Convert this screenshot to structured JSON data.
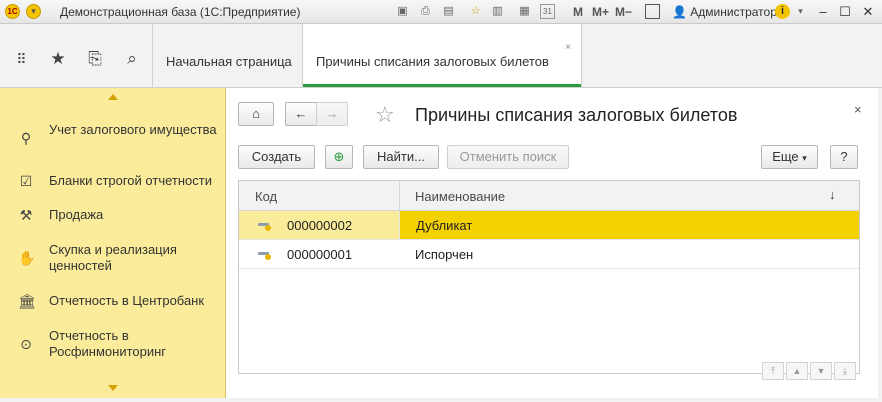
{
  "window": {
    "title": "Демонстрационная база  (1С:Предприятие)",
    "user": "Администратор",
    "m_labels": [
      "M",
      "M+",
      "M−"
    ],
    "calendar_day": "31"
  },
  "nav": {
    "tabs": [
      {
        "label": "Начальная страница",
        "active": false
      },
      {
        "label": "Причины списания залоговых билетов",
        "active": true
      }
    ],
    "tab_close": "×"
  },
  "sidebar": {
    "items": [
      {
        "label": "Учет залогового имущества",
        "icon": "ring-icon"
      },
      {
        "label": "Бланки строгой отчетности",
        "icon": "checklist-icon"
      },
      {
        "label": "Продажа",
        "icon": "sale-icon"
      },
      {
        "label": "Скупка и реализация ценностей",
        "icon": "hand-icon"
      },
      {
        "label": "Отчетность в Центробанк",
        "icon": "bank-icon"
      },
      {
        "label": "Отчетность в Росфинмониторинг",
        "icon": "magnifier-icon"
      }
    ]
  },
  "form": {
    "title": "Причины списания залоговых билетов",
    "close": "×",
    "buttons": {
      "create": "Создать",
      "find": "Найти...",
      "cancel_search": "Отменить поиск",
      "more": "Еще",
      "help": "?"
    },
    "table": {
      "columns": [
        "Код",
        "Наименование"
      ],
      "sort_indicator": "↓",
      "rows": [
        {
          "code": "000000002",
          "name": "Дубликат",
          "selected": true
        },
        {
          "code": "000000001",
          "name": "Испорчен",
          "selected": false
        }
      ]
    }
  }
}
